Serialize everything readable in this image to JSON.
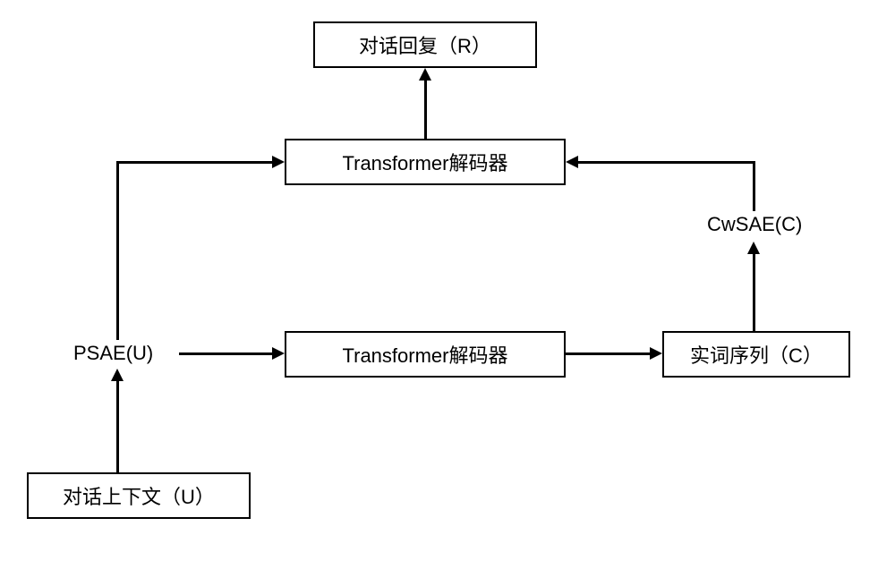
{
  "nodes": {
    "dialog_reply": "对话回复（R）",
    "transformer_decoder_top": "Transformer解码器",
    "cwsae": "CwSAE(C)",
    "transformer_decoder_mid": "Transformer解码器",
    "content_seq": "实词序列（C）",
    "psae": "PSAE(U)",
    "dialog_context": "对话上下文（U）"
  }
}
